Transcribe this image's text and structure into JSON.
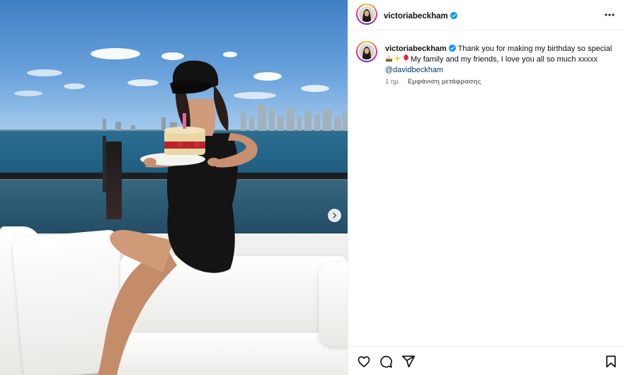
{
  "post": {
    "username": "victoriabeckham",
    "verified": true,
    "caption_text": "Thank you for making my birthday so special",
    "caption_line2": "My family and my friends, I love you all so much xxxxx",
    "caption_emojis": [
      "cake-emoji",
      "sparkles-emoji",
      "balloon-emoji"
    ],
    "mention": "@davidbeckham",
    "time_ago": "1 ημ.",
    "translate_label": "Εμφάνιση μετάφρασης"
  },
  "media": {
    "description_icons": [
      "next-arrow-icon"
    ]
  },
  "actions": {
    "icons": [
      "heart-icon",
      "comment-icon",
      "share-icon",
      "bookmark-icon"
    ]
  },
  "colors": {
    "verified_blue": "#0095f6",
    "mention_blue": "#00376b",
    "meta_gray": "#737373",
    "divider": "#efefef"
  }
}
